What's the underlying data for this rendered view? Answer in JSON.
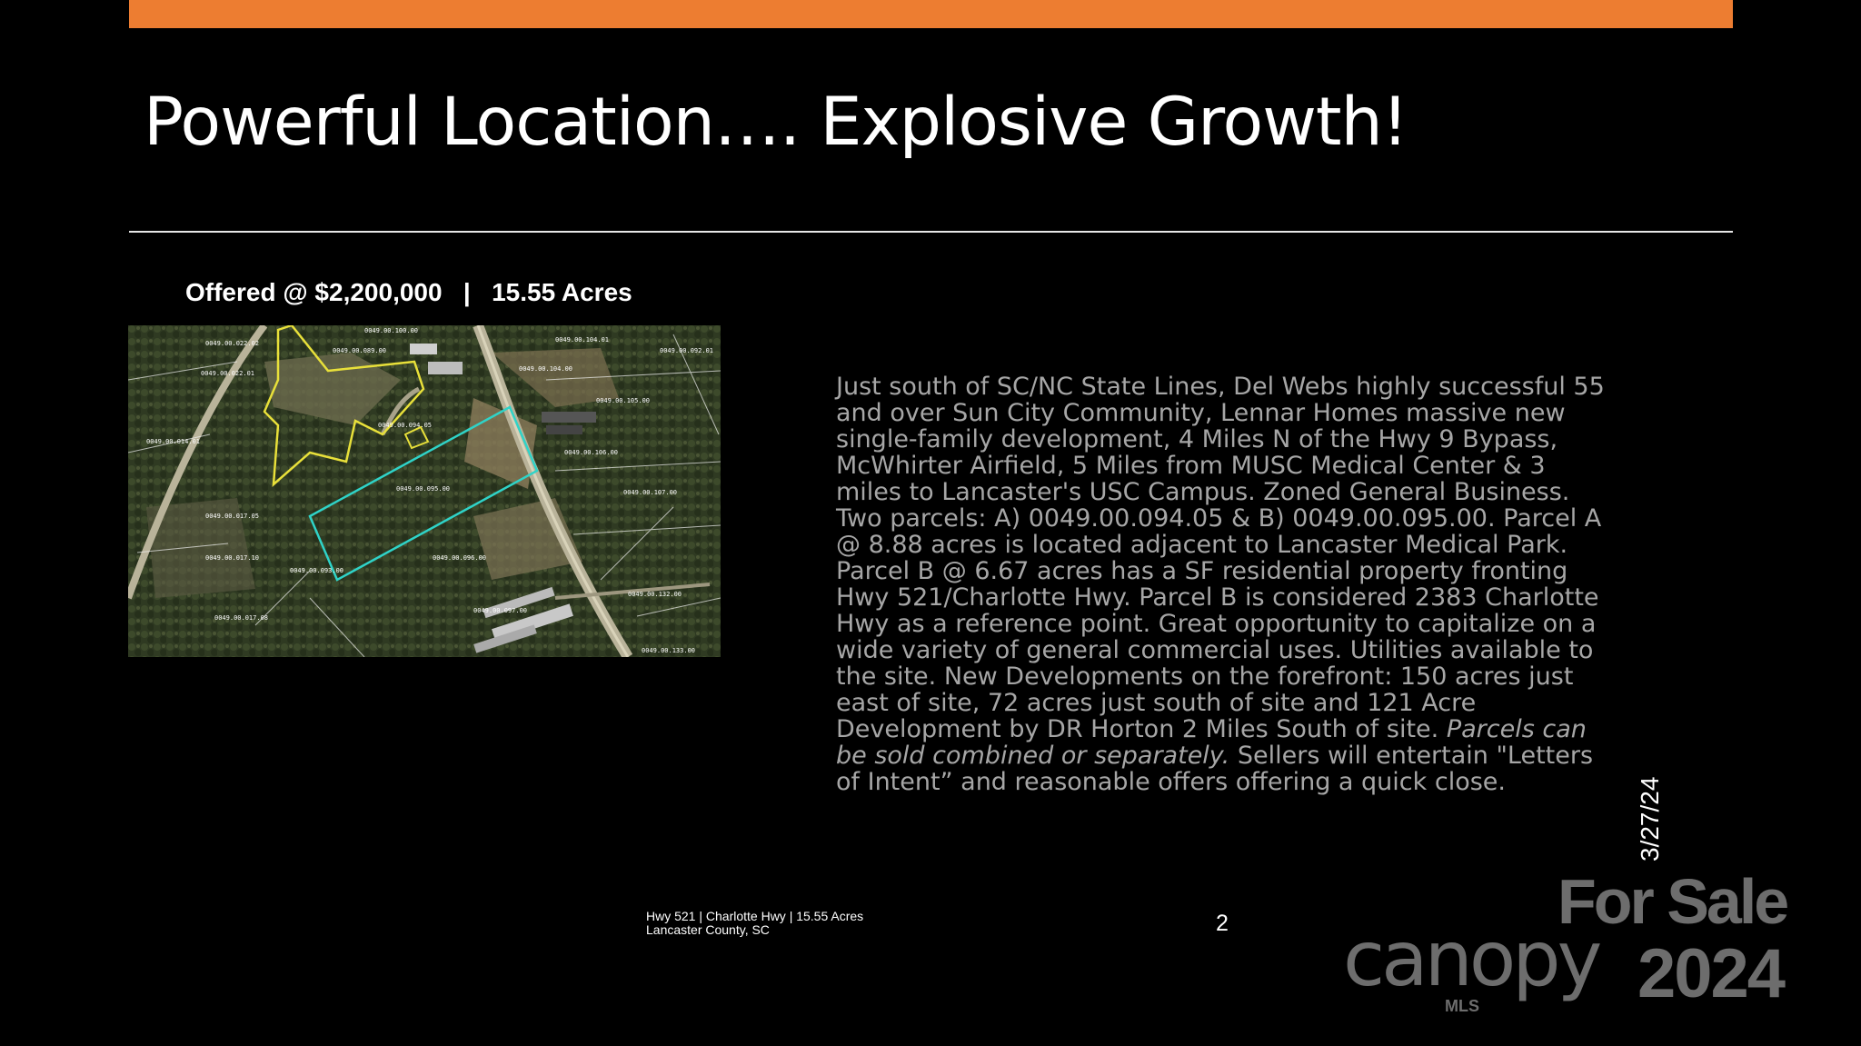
{
  "slide": {
    "title": "Powerful Location…. Explosive Growth!",
    "offer_line": "Offered @ $2,200,000   |   15.55 Acres",
    "description_parts": {
      "p1": "Just south of SC/NC State Lines, Del Webs highly successful 55 and over Sun City Community, Lennar Homes massive new single-family development, 4 Miles N of the Hwy 9 Bypass, McWhirter Airfield, 5 Miles from MUSC Medical Center & 3 miles to Lancaster's USC Campus.  Zoned General Business.  Two parcels: A) 0049.00.094.05 & B) 0049.00.095.00.  Parcel A @ 8.88 acres is located adjacent to Lancaster Medical Park. Parcel B @ 6.67 acres has a SF residential property fronting Hwy 521/Charlotte Hwy. Parcel B is considered 2383 Charlotte Hwy as a reference point. Great opportunity to capitalize on a wide variety of general commercial uses. Utilities available to the site. New Developments on the forefront: 150 acres just east of site, 72 acres just south of site and 121 Acre Development by DR Horton 2 Miles South of site. ",
      "p2_italic": "Parcels can be sold combined or separately.",
      "p3": "   Sellers will entertain \"Letters of Intent” and reasonable offers offering a quick close."
    },
    "footer_line1": "Hwy 521 | Charlotte Hwy | 15.55 Acres",
    "footer_line2": "Lancaster County, SC",
    "page_number": "2"
  },
  "map_labels": [
    "0049.00.022.02",
    "0049.00.100.00",
    "0049.00.089.00",
    "0049.00.104.01",
    "0049.00.092.01",
    "0049.00.022.01",
    "0049.00.104.00",
    "0049.00.105.00",
    "0049.00.094.05",
    "0049.00.014.01",
    "0049.00.106.00",
    "0049.00.095.00",
    "0049.00.107.00",
    "0049.00.017.05",
    "0049.00.096.00",
    "0049.00.017.10",
    "0049.00.093.00",
    "0049.00.132.00",
    "0049.00.017.08",
    "0049.00.097.00",
    "0049.00.133.00"
  ],
  "watermark": {
    "for_sale": "For Sale",
    "year": "2024",
    "brand": "canopy",
    "brand_sub": "MLS",
    "date": "3/27/24"
  },
  "colors": {
    "accent_bar": "#ED7D31",
    "background": "#000000",
    "body_text": "#A6A6A6",
    "parcel_a_outline": "#E8E03A",
    "parcel_b_outline": "#2FD3C8"
  }
}
